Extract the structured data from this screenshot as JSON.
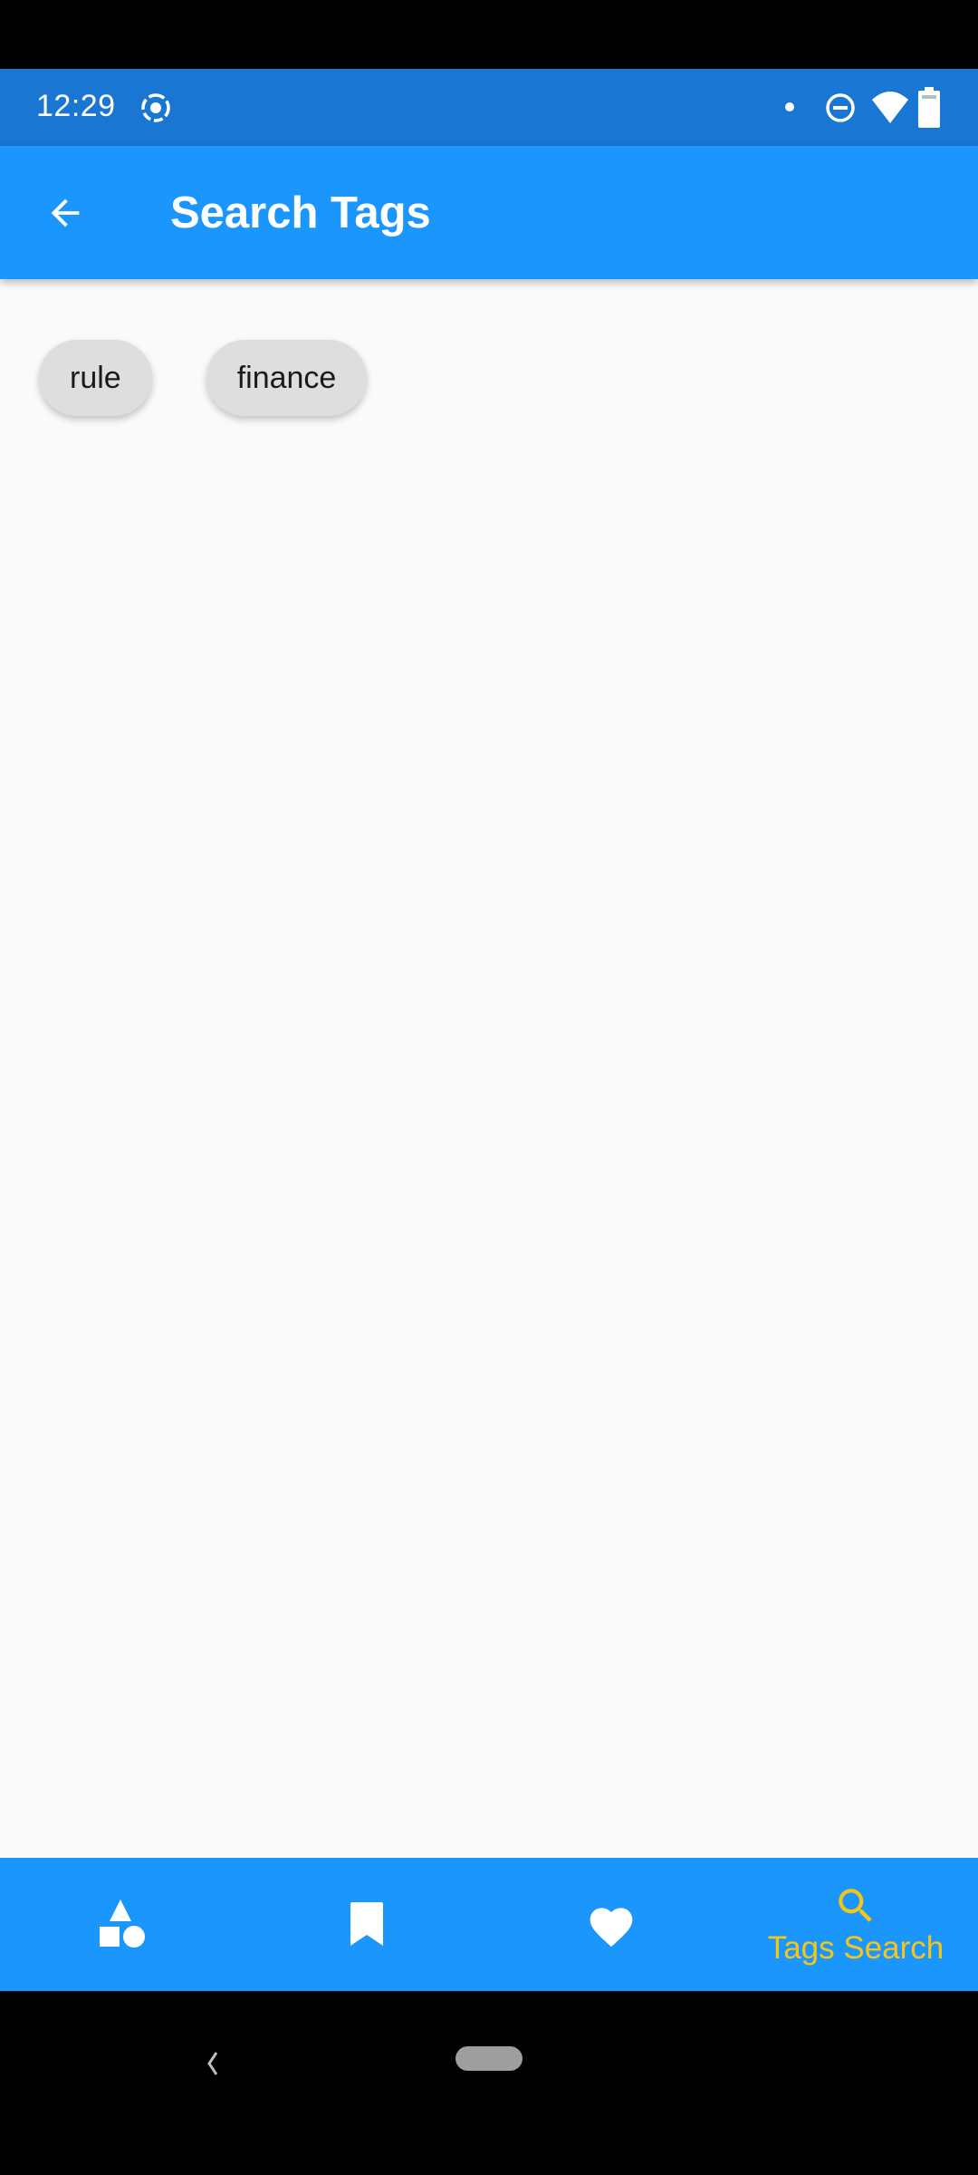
{
  "status_bar": {
    "time": "12:29",
    "left_icons": [
      "screen-record-icon"
    ],
    "right_icons": [
      "notification-dot-icon",
      "do-not-disturb-icon",
      "wifi-icon",
      "battery-icon"
    ]
  },
  "app_bar": {
    "title": "Search Tags",
    "back_icon": "arrow-back-icon"
  },
  "tags": [
    {
      "label": "rule"
    },
    {
      "label": "finance"
    }
  ],
  "bottom_nav": {
    "items": [
      {
        "icon": "category-shapes-icon",
        "label": "",
        "active": false
      },
      {
        "icon": "bookmark-icon",
        "label": "",
        "active": false
      },
      {
        "icon": "heart-icon",
        "label": "",
        "active": false
      },
      {
        "icon": "search-icon",
        "label": "Tags Search",
        "active": true
      }
    ]
  },
  "colors": {
    "status_bar": "#1976d2",
    "primary": "#1b96fc",
    "active_nav": "#f5c518",
    "chip_bg": "#dedede",
    "background": "#fafafa"
  },
  "system_nav": {
    "back_icon": "system-back-icon",
    "home_pill": "home-pill"
  }
}
